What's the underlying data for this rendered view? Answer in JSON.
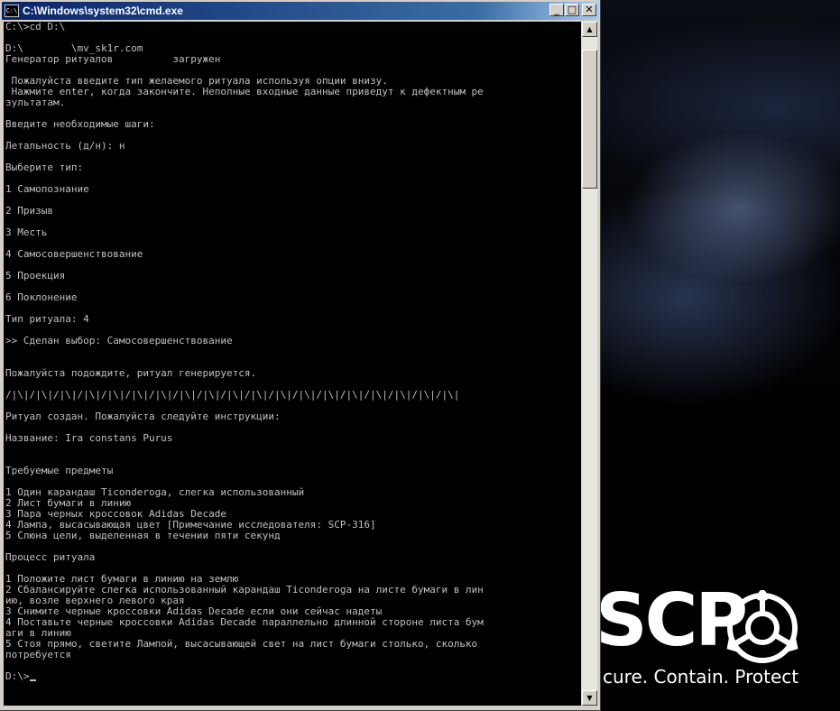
{
  "window": {
    "title": "C:\\Windows\\system32\\cmd.exe",
    "icon_label": "C:\\",
    "buttons": {
      "minimize": "_",
      "maximize": "□",
      "close": "✕"
    }
  },
  "console": {
    "lines": [
      "C:\\>cd D:\\",
      "",
      "D:\\        \\mv_sk1r.com",
      "Генератор ритуалов          загружен",
      "",
      " Пожалуйста введите тип желаемого ритуала используя опции внизу.",
      " Нажмите enter, когда закончите. Неполные входные данные приведут к дефектным ре",
      "зультатам.",
      "",
      "Введите необходимые шаги:",
      "",
      "Летальность (д/н): н",
      "",
      "Выберите тип:",
      "",
      "1 Самопознание",
      "",
      "2 Призыв",
      "",
      "3 Месть",
      "",
      "4 Самосовершенствование",
      "",
      "5 Проекция",
      "",
      "6 Поклонение",
      "",
      "Тип ритуала: 4",
      "",
      ">> Сделан выбор: Самосовершенствование",
      "",
      "",
      "Пожалуйста подождите, ритуал генерируется.",
      "",
      "/|\\|/|\\|/|\\|/|\\|/|\\|/|\\|/|\\|/|\\|/|\\|/|\\|/|\\|/|\\|/|\\|/|\\|/|\\|/|\\|/|\\|/|\\|/|\\|",
      "",
      "Ритуал создан. Пожалуйста следуйте инструкции:",
      "",
      "Название: Ira constans Purus",
      "",
      "",
      "Требуемые предметы",
      "",
      "1 Один карандаш Ticonderoga, слегка использованный",
      "2 Лист бумаги в линию",
      "3 Пара черных кроссовок Adidas Decade",
      "4 Лампа, высасывающая цвет [Примечание исследователя: SCP-316]",
      "5 Слюна цели, выделенная в течении пяти секунд",
      "",
      "Процесс ритуала",
      "",
      "1 Положите лист бумаги в линию на землю",
      "2 Сбалансируйте слегка использованный карандаш Ticonderoga на листе бумаги в лин",
      "ию, возле верхнего левого края",
      "3 Снимите черные кроссовки Adidas Decade если они сейчас надеты",
      "4 Поставьте черные кроссовки Adidas Decade параллельно длинной стороне листа бум",
      "аги в линию",
      "5 Стоя прямо, светите Лампой, высасывающей свет на лист бумаги столько, сколько",
      "потребуется",
      ""
    ],
    "prompt": "D:\\>"
  },
  "scrollbar": {
    "up_arrow": "▲",
    "down_arrow": "▼",
    "position_fraction": 0.05
  },
  "wallpaper": {
    "brand": "SCP",
    "slogan": "cure. Contain. Protect"
  },
  "colors": {
    "title_bar": "#0a246a",
    "console_bg": "#000000",
    "console_text": "#c0c0c0",
    "chrome": "#d4d0c8"
  }
}
